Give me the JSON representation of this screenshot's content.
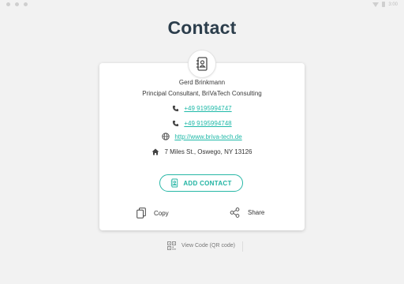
{
  "status_bar": {
    "time": "3:00"
  },
  "page": {
    "title": "Contact"
  },
  "contact": {
    "name": "Gerd Brinkmann",
    "position": "Principal Consultant, BriVaTech Consulting",
    "phone1": "+49 9195994747",
    "phone2": "+49 9195994748",
    "website": "http://www.briva-tech.de",
    "address": "7 Miles St., Oswego, NY 13126"
  },
  "actions": {
    "add_contact": "ADD CONTACT",
    "copy": "Copy",
    "share": "Share",
    "qr": "View Code (QR code)"
  },
  "colors": {
    "accent": "#20b3a2",
    "title": "#2c3e4c",
    "background": "#f2f2f2"
  },
  "icons": {
    "badge": "contact-book-icon",
    "phone": "phone-icon",
    "web": "globe-icon",
    "address": "home-icon",
    "add": "contact-book-icon",
    "copy": "copy-icon",
    "share": "share-icon",
    "qr": "qr-code-icon"
  }
}
